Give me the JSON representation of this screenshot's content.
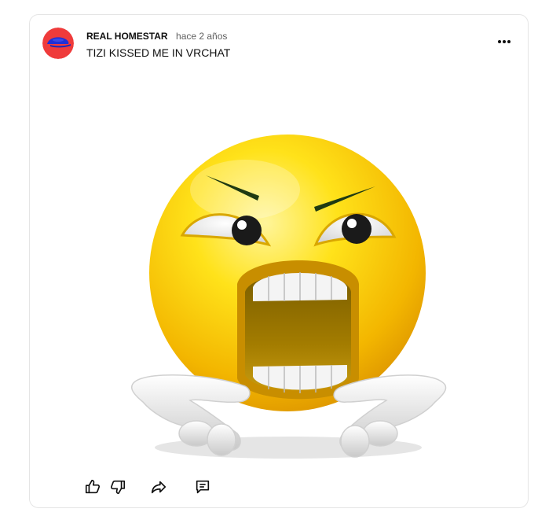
{
  "post": {
    "author": "REAL HOMESTAR",
    "time": "hace 2 años",
    "text": "TIZI KISSED ME IN VRCHAT",
    "avatar_colors": {
      "background": "#ef3b3b",
      "cap": "#1f2fd6"
    },
    "image_subject": "angry-screaming-emoji",
    "colors": {
      "author": "#0f0f0f",
      "time": "#606060",
      "border": "#e5e5e5"
    }
  },
  "menu": {
    "icon": "more-vertical-icon"
  },
  "actions": [
    {
      "name": "like",
      "icon": "thumbs-up-icon"
    },
    {
      "name": "dislike",
      "icon": "thumbs-down-icon"
    },
    {
      "name": "share",
      "icon": "share-icon"
    },
    {
      "name": "comment",
      "icon": "comment-icon"
    }
  ]
}
